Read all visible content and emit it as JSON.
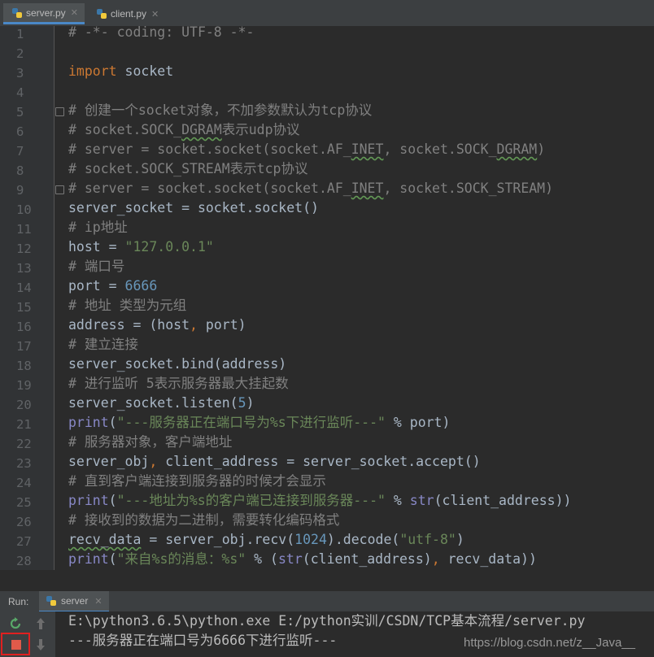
{
  "tabs": [
    {
      "label": "server.py",
      "active": true
    },
    {
      "label": "client.py",
      "active": false
    }
  ],
  "code_lines": [
    {
      "n": "1",
      "tokens": [
        {
          "t": "# -*- coding: UTF-8 -*-",
          "c": "c"
        }
      ]
    },
    {
      "n": "2",
      "tokens": []
    },
    {
      "n": "3",
      "tokens": [
        {
          "t": "import",
          "c": "k"
        },
        {
          "t": " socket",
          "c": ""
        }
      ]
    },
    {
      "n": "4",
      "tokens": []
    },
    {
      "n": "5",
      "tokens": [
        {
          "t": "# 创建一个socket对象，不加参数默认为tcp协议",
          "c": "c"
        }
      ]
    },
    {
      "n": "6",
      "tokens": [
        {
          "t": "# socket.SOCK_",
          "c": "c"
        },
        {
          "t": "DGRAM",
          "c": "c sq"
        },
        {
          "t": "表示udp协议",
          "c": "c"
        }
      ]
    },
    {
      "n": "7",
      "tokens": [
        {
          "t": "# server = socket.socket(socket.AF_",
          "c": "c"
        },
        {
          "t": "INET",
          "c": "c sq"
        },
        {
          "t": ", socket.SOCK_",
          "c": "c"
        },
        {
          "t": "DGRAM",
          "c": "c sq"
        },
        {
          "t": ")",
          "c": "c"
        }
      ]
    },
    {
      "n": "8",
      "tokens": [
        {
          "t": "# socket.SOCK_STREAM表示tcp协议",
          "c": "c"
        }
      ]
    },
    {
      "n": "9",
      "tokens": [
        {
          "t": "# server = socket.socket(socket.AF_",
          "c": "c"
        },
        {
          "t": "INET",
          "c": "c sq"
        },
        {
          "t": ", socket.SOCK_STREAM)",
          "c": "c"
        }
      ]
    },
    {
      "n": "10",
      "tokens": [
        {
          "t": "server_socket = socket.socket()",
          "c": ""
        }
      ]
    },
    {
      "n": "11",
      "tokens": [
        {
          "t": "# ip地址",
          "c": "c"
        }
      ]
    },
    {
      "n": "12",
      "tokens": [
        {
          "t": "host = ",
          "c": ""
        },
        {
          "t": "\"127.0.0.1\"",
          "c": "s"
        }
      ]
    },
    {
      "n": "13",
      "tokens": [
        {
          "t": "# 端口号",
          "c": "c"
        }
      ]
    },
    {
      "n": "14",
      "tokens": [
        {
          "t": "port = ",
          "c": ""
        },
        {
          "t": "6666",
          "c": "n"
        }
      ]
    },
    {
      "n": "15",
      "tokens": [
        {
          "t": "# 地址 类型为元组",
          "c": "c"
        }
      ]
    },
    {
      "n": "16",
      "tokens": [
        {
          "t": "address = (host",
          "c": ""
        },
        {
          "t": ",",
          "c": "k"
        },
        {
          "t": " port)",
          "c": ""
        }
      ]
    },
    {
      "n": "17",
      "tokens": [
        {
          "t": "# 建立连接",
          "c": "c"
        }
      ]
    },
    {
      "n": "18",
      "tokens": [
        {
          "t": "server_socket.bind(address)",
          "c": ""
        }
      ]
    },
    {
      "n": "19",
      "tokens": [
        {
          "t": "# 进行监听 5表示服务器最大挂起数",
          "c": "c"
        }
      ]
    },
    {
      "n": "20",
      "tokens": [
        {
          "t": "server_socket.listen(",
          "c": ""
        },
        {
          "t": "5",
          "c": "n"
        },
        {
          "t": ")",
          "c": ""
        }
      ]
    },
    {
      "n": "21",
      "tokens": [
        {
          "t": "print",
          "c": "b"
        },
        {
          "t": "(",
          "c": ""
        },
        {
          "t": "\"---服务器正在端口号为%s下进行监听---\"",
          "c": "s"
        },
        {
          "t": " % port)",
          "c": ""
        }
      ]
    },
    {
      "n": "22",
      "tokens": [
        {
          "t": "# 服务器对象，客户端地址",
          "c": "c"
        }
      ]
    },
    {
      "n": "23",
      "tokens": [
        {
          "t": "server_obj",
          "c": ""
        },
        {
          "t": ",",
          "c": "k"
        },
        {
          "t": " client_address = server_socket.accept()",
          "c": ""
        }
      ]
    },
    {
      "n": "24",
      "tokens": [
        {
          "t": "# 直到客户端连接到服务器的时候才会显示",
          "c": "c"
        }
      ]
    },
    {
      "n": "25",
      "tokens": [
        {
          "t": "print",
          "c": "b"
        },
        {
          "t": "(",
          "c": ""
        },
        {
          "t": "\"---地址为%s的客户端已连接到服务器---\"",
          "c": "s"
        },
        {
          "t": " % ",
          "c": ""
        },
        {
          "t": "str",
          "c": "b"
        },
        {
          "t": "(client_address))",
          "c": ""
        }
      ]
    },
    {
      "n": "26",
      "tokens": [
        {
          "t": "# 接收到的数据为二进制，需要转化编码格式",
          "c": "c"
        }
      ]
    },
    {
      "n": "27",
      "tokens": [
        {
          "t": "recv_data",
          "c": "sq"
        },
        {
          "t": " = server_obj.recv(",
          "c": ""
        },
        {
          "t": "1024",
          "c": "n"
        },
        {
          "t": ").decode(",
          "c": ""
        },
        {
          "t": "\"utf-8\"",
          "c": "s"
        },
        {
          "t": ")",
          "c": ""
        }
      ]
    },
    {
      "n": "28",
      "tokens": [
        {
          "t": "print",
          "c": "b"
        },
        {
          "t": "(",
          "c": ""
        },
        {
          "t": "\"来自%s的消息：%s\"",
          "c": "s"
        },
        {
          "t": " % (",
          "c": ""
        },
        {
          "t": "str",
          "c": "b"
        },
        {
          "t": "(client_address)",
          "c": ""
        },
        {
          "t": ",",
          "c": "k"
        },
        {
          "t": " recv_data))",
          "c": ""
        }
      ]
    }
  ],
  "fold_lines": [
    5,
    9
  ],
  "run": {
    "label": "Run:",
    "tab_label": "server"
  },
  "console_lines": [
    "E:\\python3.6.5\\python.exe E:/python实训/CSDN/TCP基本流程/server.py",
    "---服务器正在端口号为6666下进行监听---"
  ],
  "watermark": "https://blog.csdn.net/z__Java__",
  "colors": {
    "comment": "#808080",
    "keyword": "#cc7832",
    "string": "#6a8759",
    "number": "#6897bb",
    "builtin": "#8888c6",
    "text": "#a9b7c6",
    "stop": "#e05a4a"
  }
}
